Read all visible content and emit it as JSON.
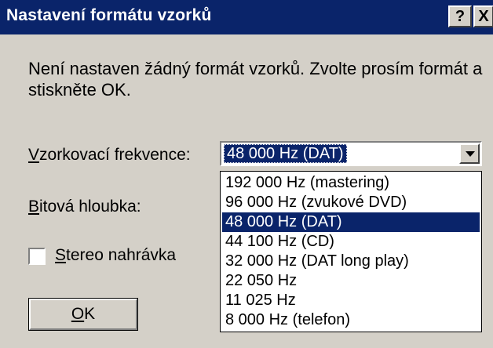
{
  "window": {
    "title": "Nastavení formátu vzorků",
    "help_button": "?",
    "close_button": "X"
  },
  "message": "Není nastaven žádný formát vzorků. Zvolte prosím formát a stiskněte OK.",
  "sample_rate": {
    "label_mnemonic": "V",
    "label_rest": "zorkovací frekvence:",
    "selected_value": "48 000 Hz (DAT)",
    "options": [
      "192 000 Hz (mastering)",
      "96 000 Hz (zvukové DVD)",
      "48 000 Hz (DAT)",
      "44 100 Hz (CD)",
      "32 000 Hz (DAT long play)",
      "22 050 Hz",
      "11 025 Hz",
      "8 000 Hz (telefon)"
    ],
    "highlighted_index": 2
  },
  "bit_depth": {
    "label_mnemonic": "B",
    "label_rest": "itová hloubka:"
  },
  "stereo": {
    "label_mnemonic": "S",
    "label_rest": "tereo nahrávka",
    "checked": false
  },
  "ok_button": {
    "mnemonic": "O",
    "rest": "K"
  },
  "colors": {
    "titlebar": "#0a246a",
    "selection": "#0a246a",
    "dialog_background": "#d4d0c8"
  }
}
